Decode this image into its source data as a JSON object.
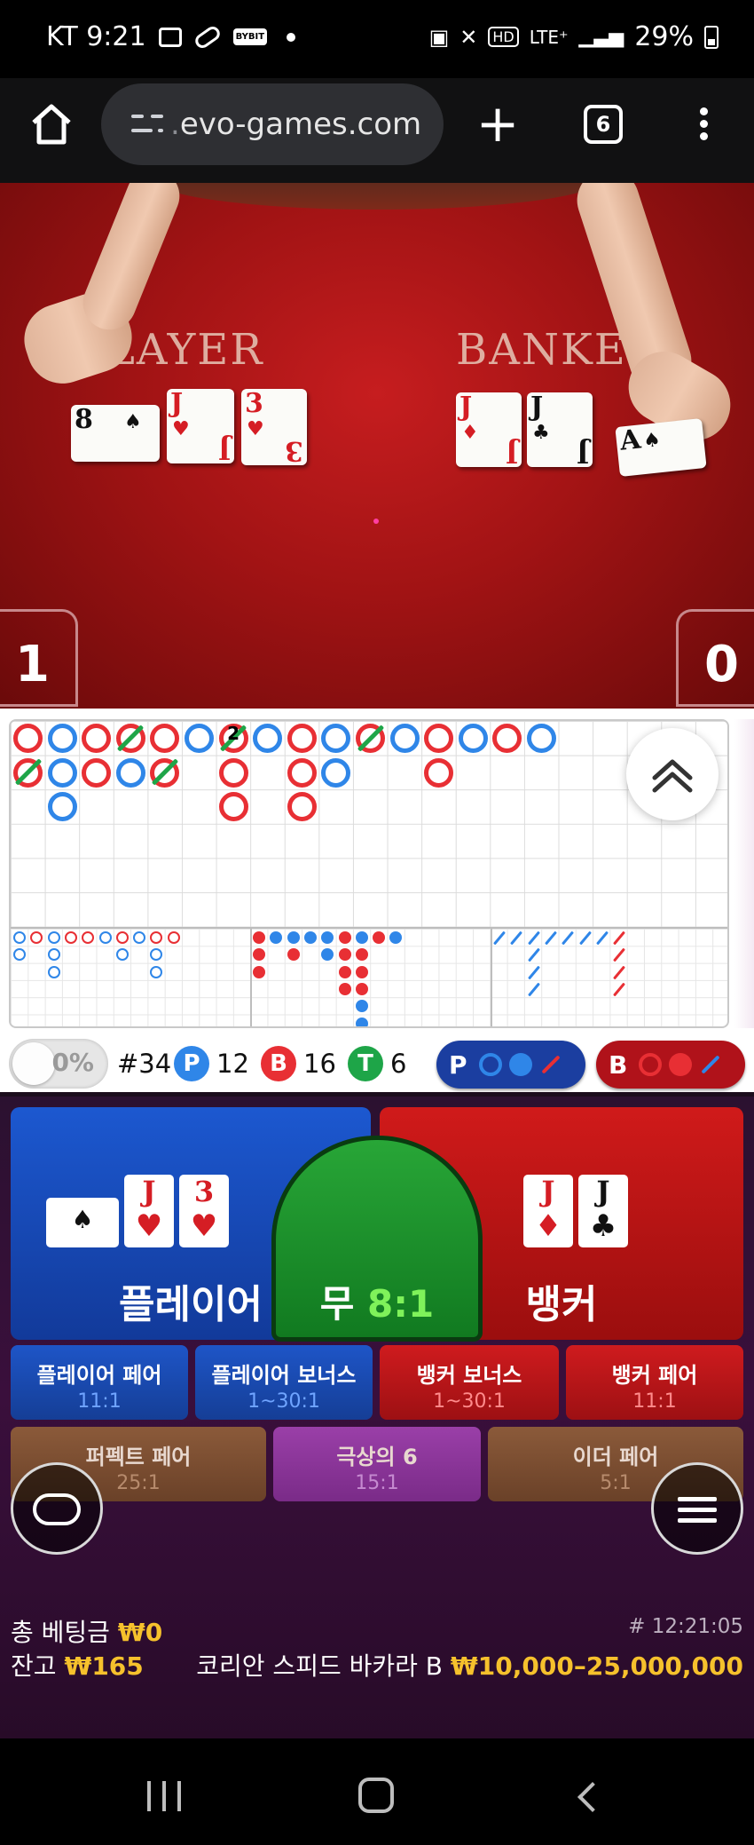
{
  "status_bar": {
    "carrier_time": "KT 9:21",
    "bybit_label": "BYBIT",
    "hd_label": "HD",
    "lte_label": "LTE⁺",
    "battery": "29%"
  },
  "browser": {
    "url_prefix": ".",
    "url": "evo-games.com",
    "tab_count": "6"
  },
  "video": {
    "player_word": "LAYER",
    "banker_word": "BANKER",
    "player_score": "1",
    "banker_score": "0"
  },
  "roadmap": {
    "tie_count_label": "2"
  },
  "stats": {
    "percent": "0%",
    "round_no": "#34",
    "player_letter": "P",
    "player_count": "12",
    "banker_letter": "B",
    "banker_count": "16",
    "tie_letter": "T",
    "tie_count": "6",
    "player_predict_letter": "P",
    "banker_predict_letter": "B"
  },
  "bets": {
    "player_label": "플레이어",
    "banker_label": "뱅커",
    "tie_label": "무",
    "tie_odds": "8:1",
    "player_cards": [
      {
        "rank": "8",
        "suit": "♠"
      },
      {
        "rank": "J",
        "suit": "♥"
      },
      {
        "rank": "3",
        "suit": "♥"
      }
    ],
    "banker_cards": [
      {
        "rank": "J",
        "suit": "♦"
      },
      {
        "rank": "J",
        "suit": "♣"
      }
    ],
    "side": [
      {
        "name": "플레이어 페어",
        "odds": "11:1"
      },
      {
        "name": "플레이어 보너스",
        "odds": "1~30:1"
      },
      {
        "name": "뱅커 보너스",
        "odds": "1~30:1"
      },
      {
        "name": "뱅커 페어",
        "odds": "11:1"
      }
    ],
    "extra": [
      {
        "name": "퍼펙트 페어",
        "odds": "25:1"
      },
      {
        "name": "극상의 6",
        "odds": "15:1"
      },
      {
        "name": "이더 페어",
        "odds": "5:1"
      }
    ]
  },
  "footer": {
    "total_bet_label": "총 베팅금",
    "total_bet_value": "₩0",
    "balance_label": "잔고",
    "balance_value": "₩165",
    "game_id": "# 12:21:05",
    "table_name": "코리안 스피드 바카라 B",
    "limits": "₩10,000–25,000,000"
  },
  "colors": {
    "player_blue": "#2f86e8",
    "banker_red": "#e82f34",
    "tie_green": "#1ea548",
    "gold": "#f6c12c"
  }
}
